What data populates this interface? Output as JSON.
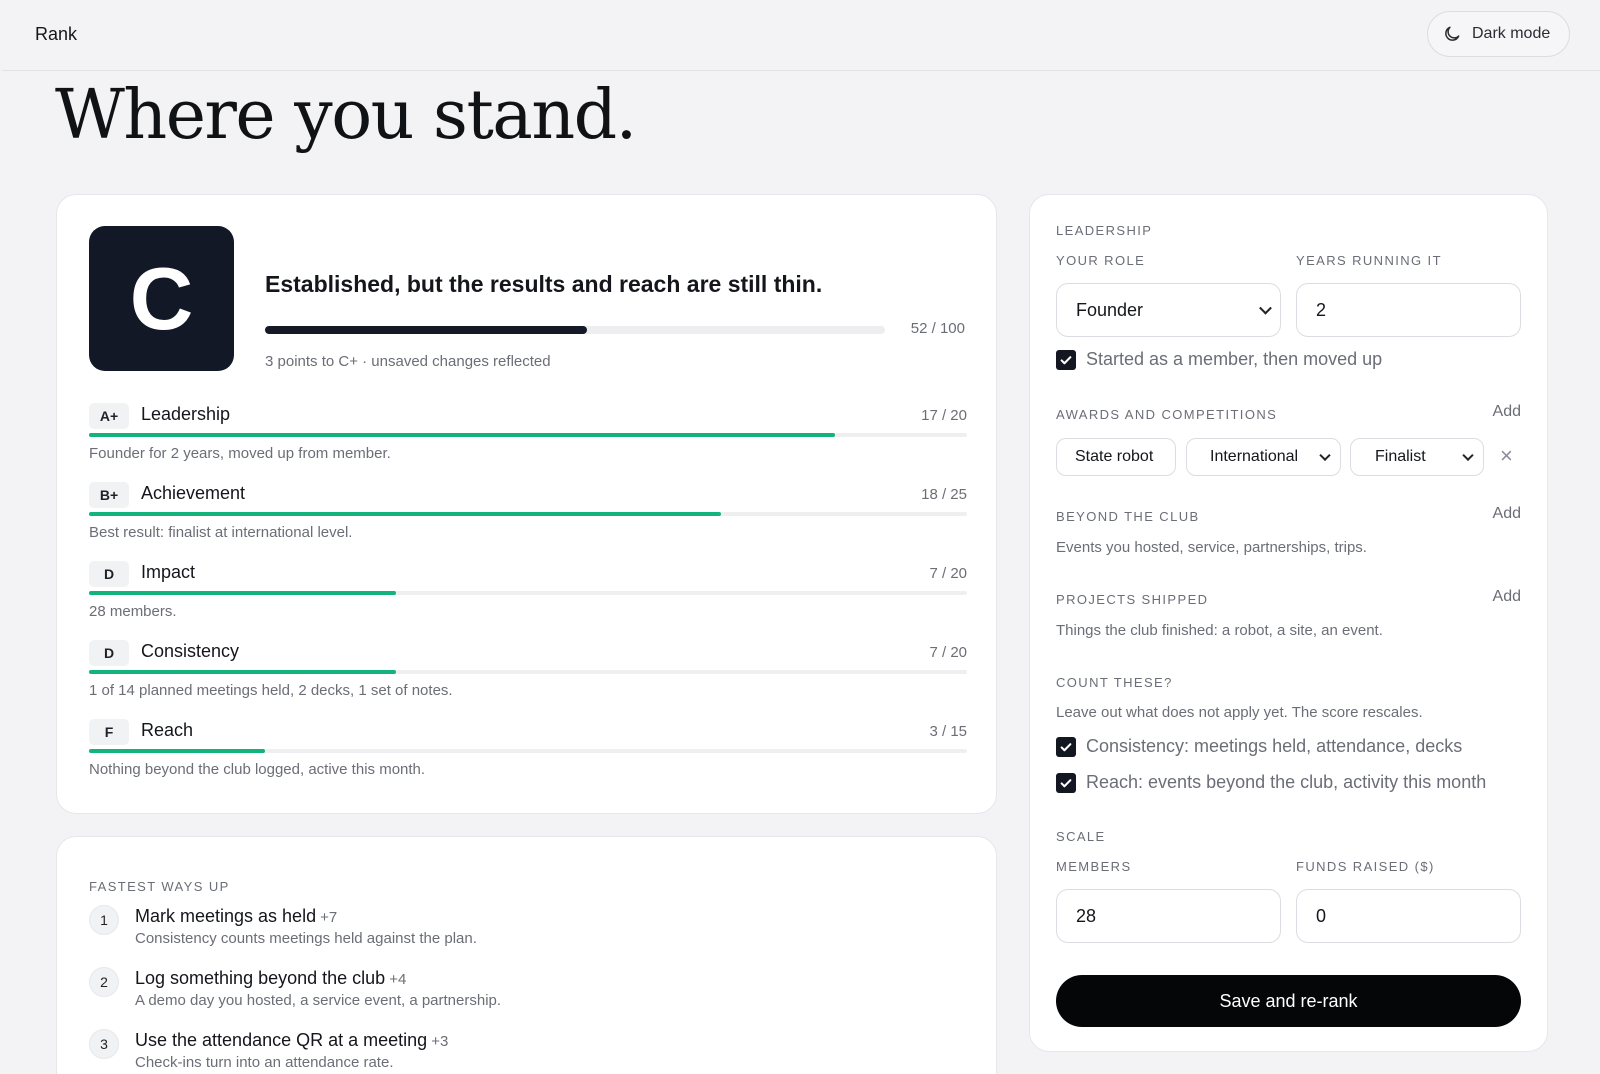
{
  "topbar": {
    "brand": "Rank",
    "dark_mode_label": "Dark mode"
  },
  "hero": {
    "title": "Where you stand."
  },
  "summary": {
    "grade": "C",
    "verdict": "Established, but the results and reach are still thin.",
    "score": 52,
    "score_max": 100,
    "score_text": "52 / 100",
    "note": "3 points to C+ · unsaved changes reflected"
  },
  "categories": [
    {
      "badge": "A+",
      "name": "Leadership",
      "points": "17 / 20",
      "value": 17,
      "max": 20,
      "desc": "Founder for 2 years, moved up from member."
    },
    {
      "badge": "B+",
      "name": "Achievement",
      "points": "18 / 25",
      "value": 18,
      "max": 25,
      "desc": "Best result: finalist at international level."
    },
    {
      "badge": "D",
      "name": "Impact",
      "points": "7 / 20",
      "value": 7,
      "max": 20,
      "desc": "28 members."
    },
    {
      "badge": "D",
      "name": "Consistency",
      "points": "7 / 20",
      "value": 7,
      "max": 20,
      "desc": "1 of 14 planned meetings held, 2 decks, 1 set of notes."
    },
    {
      "badge": "F",
      "name": "Reach",
      "points": "3 / 15",
      "value": 3,
      "max": 15,
      "desc": "Nothing beyond the club logged, active this month."
    }
  ],
  "ways": {
    "label": "Fastest ways up",
    "items": [
      {
        "num": "1",
        "title": "Mark meetings as held",
        "plus": "+7",
        "desc": "Consistency counts meetings held against the plan."
      },
      {
        "num": "2",
        "title": "Log something beyond the club",
        "plus": "+4",
        "desc": "A demo day you hosted, a service event, a partnership."
      },
      {
        "num": "3",
        "title": "Use the attendance QR at a meeting",
        "plus": "+3",
        "desc": "Check-ins turn into an attendance rate."
      }
    ]
  },
  "side": {
    "leadership": {
      "section": "Leadership",
      "role_label": "Your role",
      "role_value": "Founder",
      "years_label": "Years running it",
      "years_value": "2",
      "started_member": "Started as a member, then moved up"
    },
    "awards": {
      "section": "Awards and competitions",
      "add": "Add",
      "name": "State robot",
      "level": "International",
      "result": "Finalist",
      "remove": "×"
    },
    "beyond": {
      "section": "Beyond the club",
      "add": "Add",
      "help": "Events you hosted, service, partnerships, trips."
    },
    "projects": {
      "section": "Projects shipped",
      "add": "Add",
      "help": "Things the club finished: a robot, a site, an event."
    },
    "count": {
      "section": "Count these?",
      "help": "Leave out what does not apply yet. The score rescales.",
      "consistency": "Consistency: meetings held, attendance, decks",
      "reach": "Reach: events beyond the club, activity this month"
    },
    "scale": {
      "section": "Scale",
      "members_label": "Members",
      "members_value": "28",
      "funds_label": "Funds raised ($)",
      "funds_value": "0"
    },
    "save": "Save and re-rank"
  },
  "colors": {
    "accent": "#12b47c",
    "dark": "#121826"
  }
}
